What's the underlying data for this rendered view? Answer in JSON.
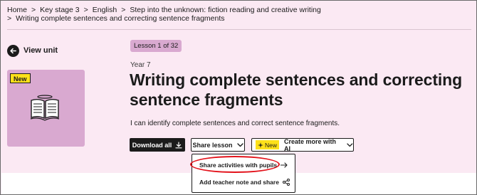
{
  "breadcrumb": {
    "items": [
      "Home",
      "Key stage 3",
      "English",
      "Step into the unknown: fiction reading and creative writing",
      "Writing complete sentences and correcting sentence fragments"
    ],
    "separator": ">"
  },
  "nav": {
    "view_unit": "View unit"
  },
  "lesson_card": {
    "badge": "New"
  },
  "lesson": {
    "pill": "Lesson 1 of 32",
    "year": "Year 7",
    "title": "Writing complete sentences and correcting sentence fragments",
    "objective": "I can identify complete sentences and correct sentence fragments."
  },
  "actions": {
    "download_all": "Download all",
    "share_lesson": "Share lesson",
    "ai_badge": "New",
    "create_ai": "Create more with AI"
  },
  "share_menu": {
    "items": [
      "Share activities with pupils",
      "Add teacher note and share"
    ]
  },
  "colors": {
    "background": "#fbe9f3",
    "card": "#d9a9d0",
    "badge": "#fde11a",
    "highlight": "#e3121b",
    "dark": "#1b1b1b"
  }
}
